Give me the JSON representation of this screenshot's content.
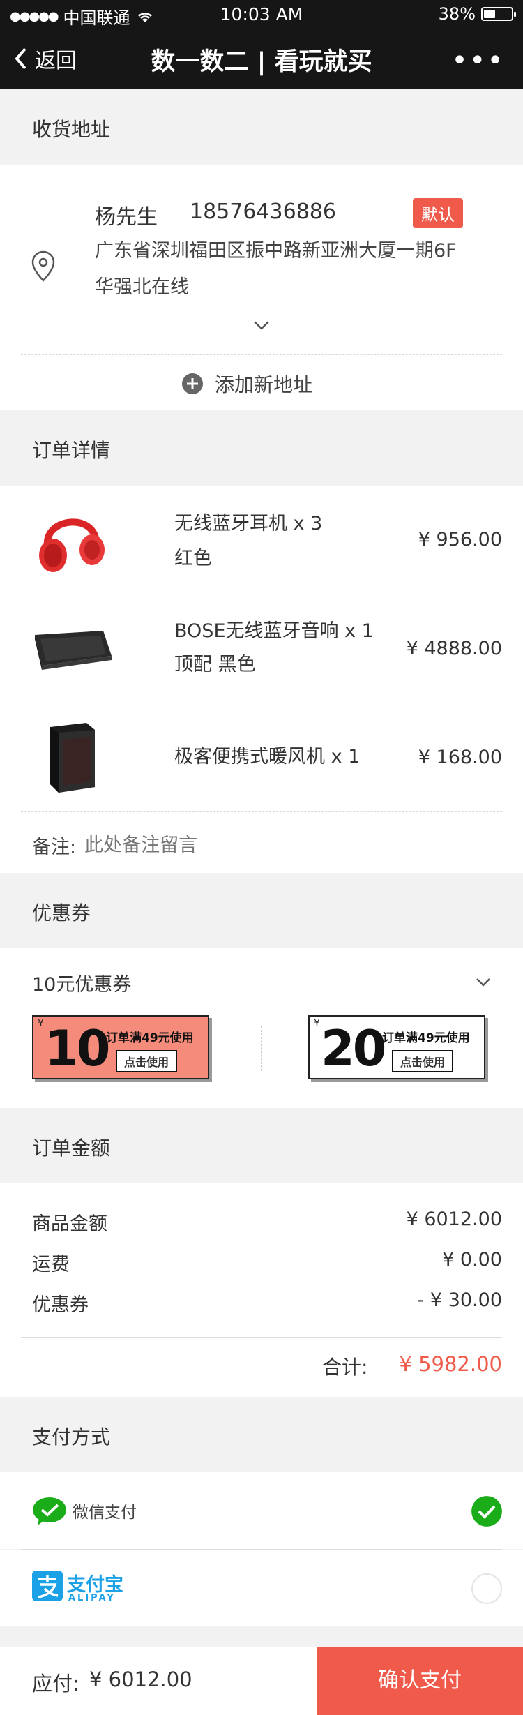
{
  "status": {
    "carrier": "中国联通",
    "time": "10:03 AM",
    "battery": "38%"
  },
  "nav": {
    "back_label": "返回",
    "title": "数一数二 | 看玩就买",
    "more": "•••"
  },
  "address": {
    "section_title": "收货地址",
    "name": "杨先生",
    "phone": "18576436886",
    "default_badge": "默认",
    "line1": "广东省深圳福田区振中路新亚洲大厦一期6F",
    "line2": "华强北在线",
    "add_new": "添加新地址"
  },
  "order": {
    "section_title": "订单详情",
    "items": [
      {
        "name": "无线蓝牙耳机 x 3",
        "spec": "红色",
        "price": "¥ 956.00"
      },
      {
        "name": "BOSE无线蓝牙音响 x 1",
        "spec": "顶配 黑色",
        "price": "¥ 4888.00"
      },
      {
        "name": "极客便携式暖风机 x 1",
        "spec": "",
        "price": "¥ 168.00"
      }
    ],
    "remark_label": "备注:",
    "remark_placeholder": "此处备注留言"
  },
  "coupons": {
    "section_title": "优惠券",
    "selected": "10元优惠券",
    "list": [
      {
        "yen": "¥",
        "amount": "10",
        "condition": "订单满49元使用",
        "button": "点击使用",
        "color": "#f58b7b"
      },
      {
        "yen": "¥",
        "amount": "20",
        "condition": "订单满49元使用",
        "button": "点击使用",
        "color": "#ffffff"
      }
    ]
  },
  "amount": {
    "section_title": "订单金额",
    "goods_label": "商品金额",
    "goods_value": "¥ 6012.00",
    "shipping_label": "运费",
    "shipping_value": "¥ 0.00",
    "coupon_label": "优惠券",
    "coupon_value": "- ¥ 30.00",
    "total_label": "合计:",
    "total_value": "¥ 5982.00"
  },
  "payment": {
    "section_title": "支付方式",
    "wechat_label": "微信支付",
    "alipay_label": "支付宝",
    "alipay_sub": "ALIPAY"
  },
  "footer": {
    "due_label": "应付:",
    "due_value": "¥ 6012.00",
    "confirm": "确认支付"
  },
  "colors": {
    "accent": "#f05a4a",
    "wechat": "#1aad19",
    "alipay": "#1ba1e6"
  }
}
